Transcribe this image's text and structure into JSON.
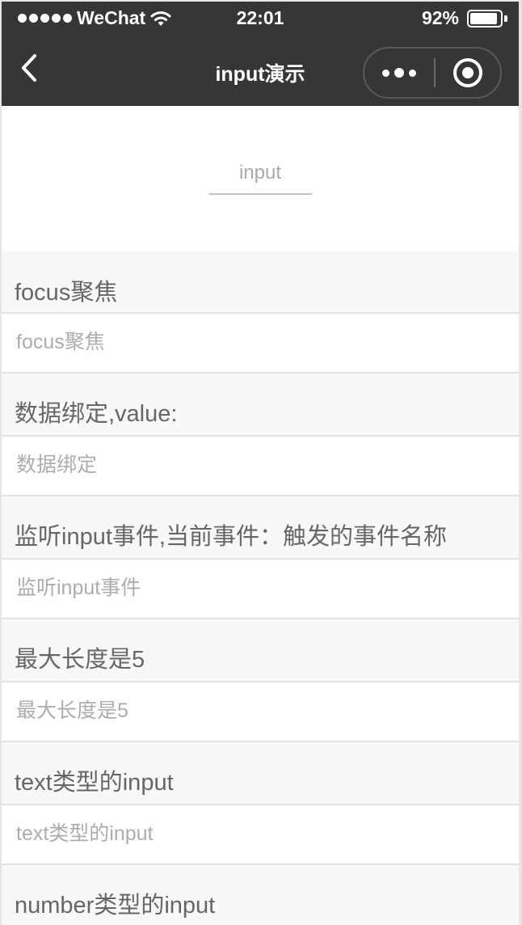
{
  "status_bar": {
    "carrier": "WeChat",
    "time": "22:01",
    "battery_percent": "92%",
    "battery_level": 0.92
  },
  "nav": {
    "title": "input演示",
    "back_icon": "chevron-left-icon",
    "more_icon": "more-dots-icon",
    "close_icon": "target-close-icon"
  },
  "hero": {
    "placeholder": "input"
  },
  "sections": [
    {
      "title": "focus聚焦",
      "placeholder": "focus聚焦"
    },
    {
      "title": "数据绑定,value:",
      "placeholder": "数据绑定"
    },
    {
      "title": "监听input事件,当前事件：触发的事件名称",
      "placeholder": "监听input事件"
    },
    {
      "title": "最大长度是5",
      "placeholder": "最大长度是5"
    },
    {
      "title": "text类型的input",
      "placeholder": "text类型的input"
    },
    {
      "title": "number类型的input",
      "placeholder": ""
    }
  ],
  "colors": {
    "nav_background": "#363636",
    "page_background": "#f8f8f8",
    "field_background": "#ffffff",
    "title_text": "#666666",
    "placeholder_text": "#adadad"
  }
}
